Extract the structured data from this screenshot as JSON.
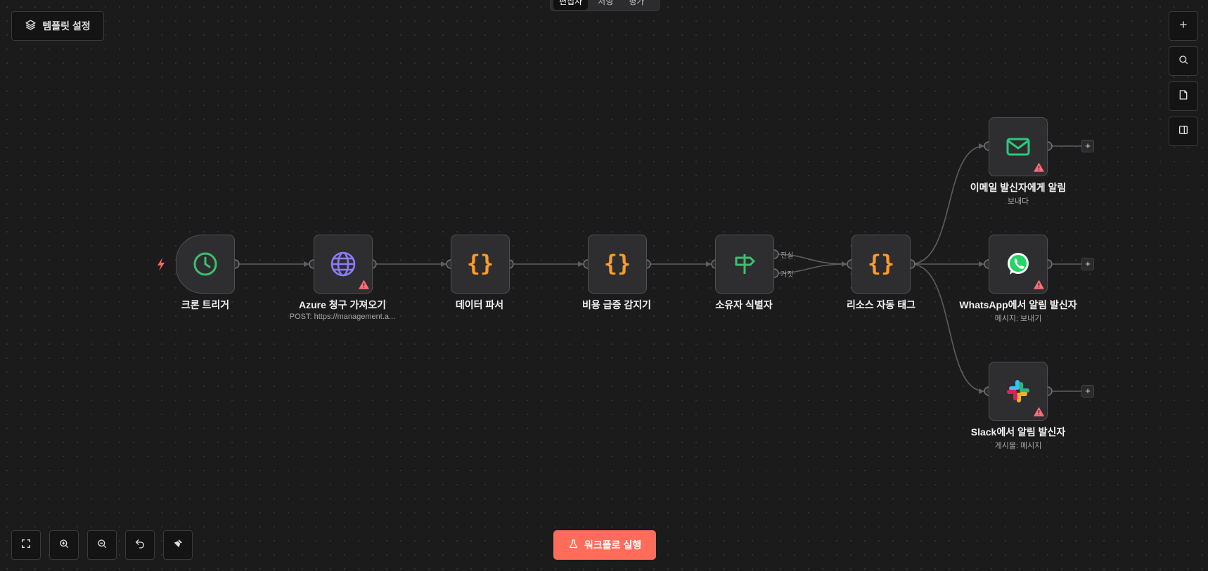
{
  "toolbar": {
    "template_settings_label": "템플릿 설정",
    "tabs": [
      "편집자",
      "처형",
      "평가"
    ],
    "run_label": "워크플로 실행"
  },
  "colors": {
    "run_button": "#ff6d5a",
    "warning": "#ff6d7a",
    "braces": "#ff9b26",
    "clock": "#3cbf72",
    "globe": "#8b7cf6",
    "signpost": "#3cbf72",
    "email": "#2bc97f",
    "whatsapp": "#25d366"
  },
  "nodes": [
    {
      "label": "크론 트리거",
      "subtitle": "",
      "icon": "clock-icon"
    },
    {
      "label": "Azure 청구 가져오기",
      "subtitle": "POST: https://management.a...",
      "icon": "globe-icon"
    },
    {
      "label": "데이터 파서",
      "subtitle": "",
      "icon": "braces-icon"
    },
    {
      "label": "비용 급증 감지기",
      "subtitle": "",
      "icon": "braces-icon"
    },
    {
      "label": "소유자 식별자",
      "subtitle": "",
      "icon": "signpost-icon"
    },
    {
      "label": "리소스 자동 태그",
      "subtitle": "",
      "icon": "braces-icon"
    },
    {
      "label": "이메일 발신자에게 알림",
      "subtitle": "보내다",
      "icon": "mail-icon"
    },
    {
      "label": "WhatsApp에서 알림 발신자",
      "subtitle": "메시지: 보내기",
      "icon": "whatsapp-icon"
    },
    {
      "label": "Slack에서 알림 발신자",
      "subtitle": "게시물: 메시지",
      "icon": "slack-icon"
    }
  ],
  "branch_labels": {
    "true": "진실",
    "false": "거짓"
  }
}
